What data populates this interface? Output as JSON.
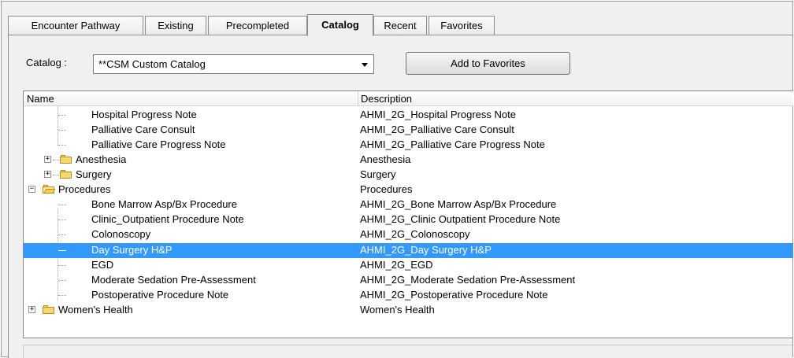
{
  "tabs": [
    {
      "label": "Encounter Pathway"
    },
    {
      "label": "Existing"
    },
    {
      "label": "Precompleted"
    },
    {
      "label": "Catalog"
    },
    {
      "label": "Recent"
    },
    {
      "label": "Favorites"
    }
  ],
  "active_tab": "Catalog",
  "catalog": {
    "label": "Catalog :",
    "value": "**CSM Custom Catalog"
  },
  "add_favorites_label": "Add to Favorites",
  "list": {
    "columns": [
      "Name",
      "Description"
    ],
    "rows": [
      {
        "name": "Hospital Progress Note",
        "desc": "AHMI_2G_Hospital Progress Note"
      },
      {
        "name": "Palliative Care Consult",
        "desc": "AHMI_2G_Palliative Care Consult"
      },
      {
        "name": "Palliative Care Progress Note",
        "desc": "AHMI_2G_Palliative Care Progress Note"
      },
      {
        "name": "Anesthesia",
        "desc": "Anesthesia"
      },
      {
        "name": "Surgery",
        "desc": "Surgery"
      },
      {
        "name": "Procedures",
        "desc": "Procedures"
      },
      {
        "name": "Bone Marrow Asp/Bx Procedure",
        "desc": "AHMI_2G_Bone Marrow Asp/Bx Procedure"
      },
      {
        "name": "Clinic_Outpatient Procedure Note",
        "desc": "AHMI_2G_Clinic Outpatient Procedure Note"
      },
      {
        "name": "Colonoscopy",
        "desc": "AHMI_2G_Colonoscopy"
      },
      {
        "name": "Day Surgery H&P",
        "desc": "AHMI_2G_Day Surgery H&P"
      },
      {
        "name": "EGD",
        "desc": "AHMI_2G_EGD"
      },
      {
        "name": "Moderate Sedation Pre-Assessment",
        "desc": "AHMI_2G_Moderate Sedation Pre-Assessment"
      },
      {
        "name": "Postoperative Procedure Note",
        "desc": "AHMI_2G_Postoperative Procedure Note"
      },
      {
        "name": "Women's Health",
        "desc": "Women's Health"
      }
    ]
  },
  "colors": {
    "selection": "#3399ff",
    "folder": "#f6d96b"
  }
}
